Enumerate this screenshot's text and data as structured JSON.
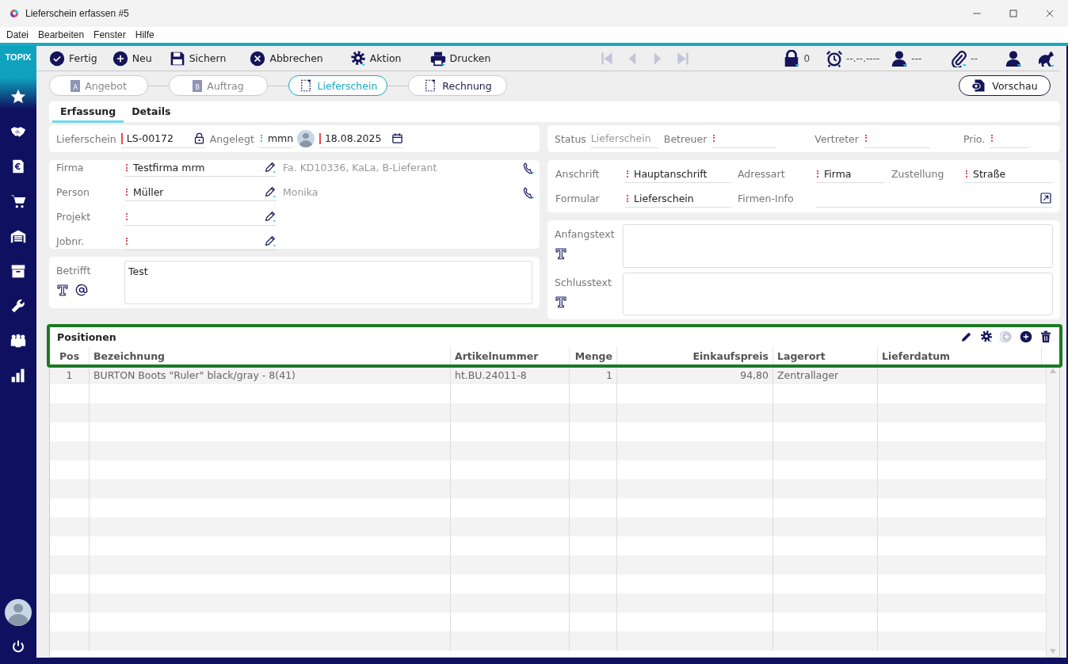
{
  "window": {
    "title": "Lieferschein erfassen #5"
  },
  "menu": [
    {
      "label": "Datei"
    },
    {
      "label": "Bearbeiten"
    },
    {
      "label": "Fenster"
    },
    {
      "label": "Hilfe"
    }
  ],
  "sidebar": {
    "logo": "TOPIX"
  },
  "toolbar": {
    "buttons": [
      {
        "label": "Fertig"
      },
      {
        "label": "Neu"
      },
      {
        "label": "Sichern"
      },
      {
        "label": "Abbrechen"
      },
      {
        "label": "Aktion"
      },
      {
        "label": "Drucken"
      }
    ],
    "navigation": [
      {
        "disabled": true
      },
      {
        "disabled": true
      },
      {
        "disabled": true
      },
      {
        "disabled": true
      }
    ],
    "indicators": [
      {
        "text": "0"
      },
      {
        "text": "--.--.----"
      },
      {
        "text": "---"
      },
      {
        "text": "--"
      }
    ]
  },
  "stages": [
    {
      "label": "Angebot",
      "letter": "A",
      "selected": false,
      "disabled": true
    },
    {
      "label": "Auftrag",
      "letter": "B",
      "selected": false,
      "disabled": true
    },
    {
      "label": "Lieferschein",
      "selected": true,
      "disabled": false
    },
    {
      "label": "Rechnung",
      "selected": false,
      "disabled": false
    }
  ],
  "preview_button": "Vorschau",
  "subtabs": [
    {
      "label": "Erfassung",
      "selected": true
    },
    {
      "label": "Details",
      "selected": false
    }
  ],
  "document_header": {
    "number": {
      "label": "Lieferschein",
      "value": "LS-00172",
      "mandatory": true,
      "locked": true
    },
    "created": {
      "label": "Angelegt",
      "user": "mmn",
      "user_linked": true,
      "date": "18.08.2025",
      "date_mandatory": true
    }
  },
  "status_panel": {
    "fields": [
      {
        "label": "Status",
        "value": "Lieferschein",
        "readonly": true
      },
      {
        "label": "Betreuer",
        "required": true
      },
      {
        "label": "Vertreter",
        "required": true
      },
      {
        "label": "Prio.",
        "required": true
      }
    ]
  },
  "contact": {
    "rows": [
      {
        "label": "Firma",
        "value": "Testfirma mrm",
        "required": true,
        "note": "Fa. KD10336, KaLa, B-Lieferant"
      },
      {
        "label": "Person",
        "value": "Müller",
        "required": true,
        "note": "Monika"
      },
      {
        "label": "Projekt",
        "required": true
      },
      {
        "label": "Jobnr.",
        "required": true
      }
    ]
  },
  "subject": {
    "label": "Betrifft",
    "value": "Test"
  },
  "address": {
    "rows": [
      {
        "fields": [
          {
            "label": "Anschrift",
            "value": "Hauptanschrift",
            "required": true
          },
          {
            "label": "Adressart",
            "value": "Firma",
            "required": true
          },
          {
            "label": "Zustellung",
            "value": "Straße",
            "required": true
          }
        ]
      },
      {
        "fields": [
          {
            "label": "Formular",
            "value": "Lieferschein",
            "required": true
          },
          {
            "label": "Firmen-Info",
            "kind": "link"
          }
        ]
      }
    ]
  },
  "texts": [
    {
      "label": "Anfangstext"
    },
    {
      "label": "Schlusstext"
    }
  ],
  "positions": {
    "title": "Positionen",
    "highlight": true,
    "tools": [
      {
        "disabled": false
      },
      {
        "disabled": false
      },
      {
        "disabled": true
      },
      {
        "disabled": false
      },
      {
        "disabled": false
      }
    ],
    "columns": [
      {
        "label": "Pos"
      },
      {
        "label": "Bezeichnung"
      },
      {
        "label": "Artikelnummer"
      },
      {
        "label": "Menge"
      },
      {
        "label": "Einkaufspreis"
      },
      {
        "label": "Lagerort"
      },
      {
        "label": "Lieferdatum"
      }
    ],
    "rows": [
      {
        "cells": [
          "1",
          "BURTON Boots \"Ruler\" black/gray - 8(41)",
          "ht.BU.24011-8",
          "1",
          "94,80",
          "Zentrallager"
        ]
      }
    ]
  }
}
